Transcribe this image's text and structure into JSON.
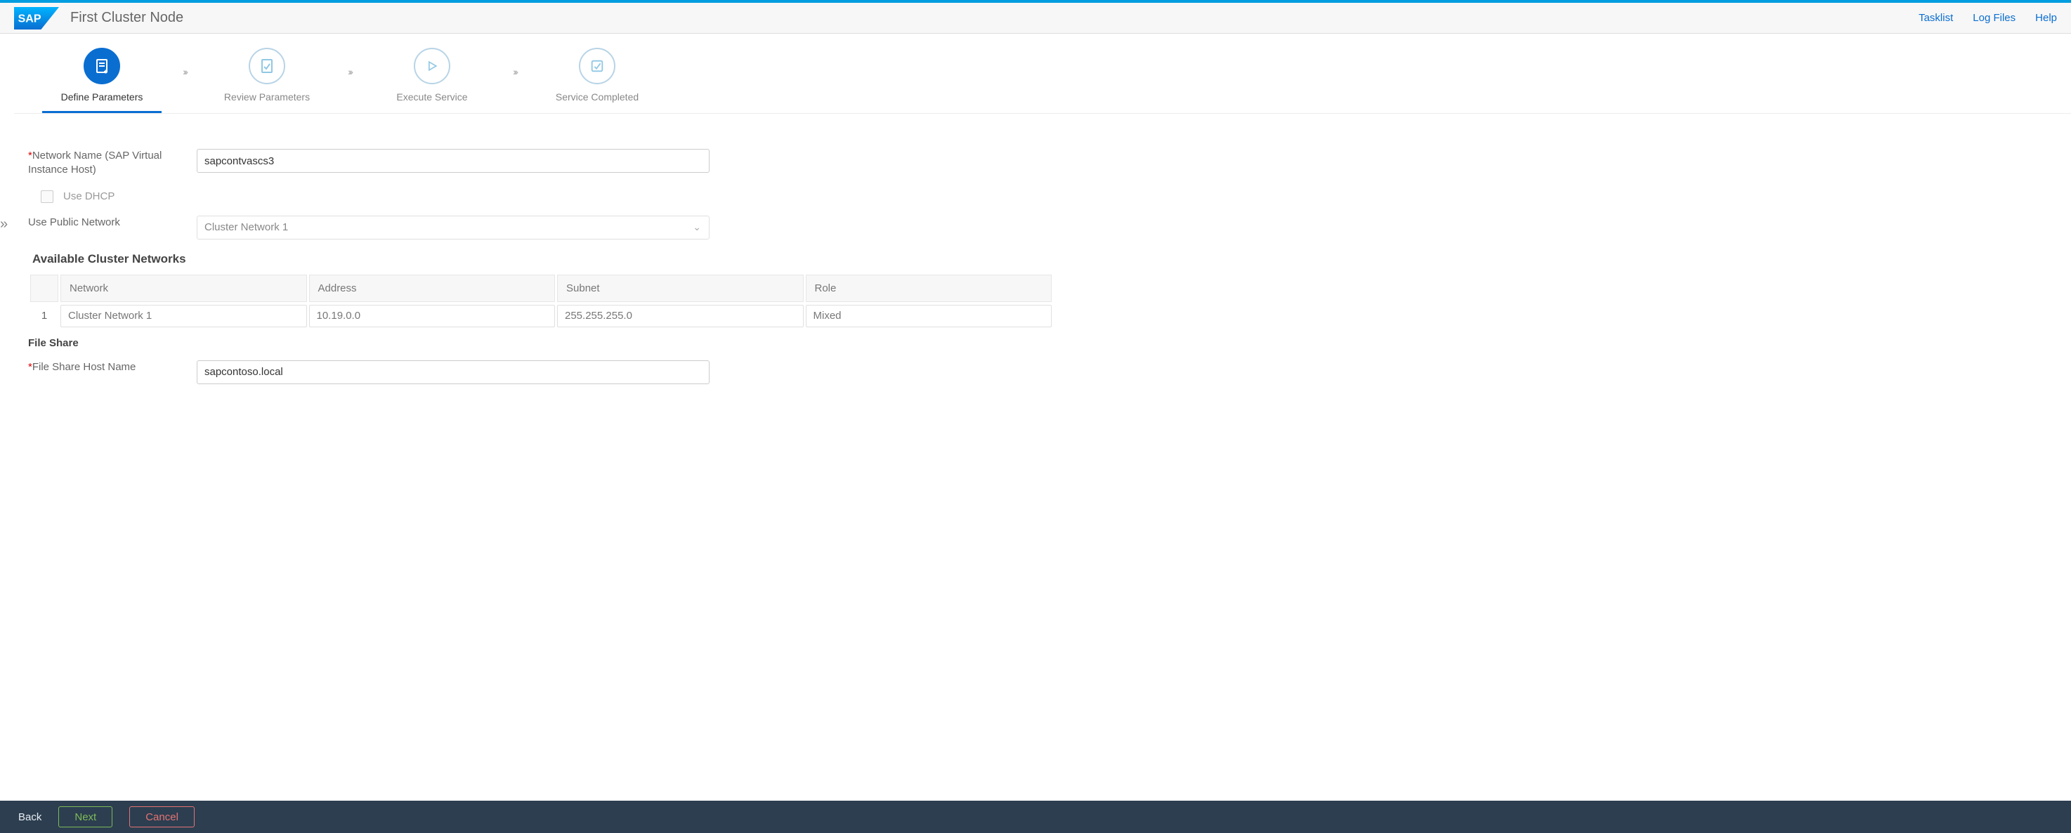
{
  "header": {
    "logo_text": "SAP",
    "title": "First Cluster Node",
    "links": {
      "tasklist": "Tasklist",
      "logfiles": "Log Files",
      "help": "Help"
    }
  },
  "wizard": {
    "steps": [
      {
        "label": "Define Parameters",
        "active": true
      },
      {
        "label": "Review Parameters",
        "active": false
      },
      {
        "label": "Execute Service",
        "active": false
      },
      {
        "label": "Service Completed",
        "active": false
      }
    ]
  },
  "form": {
    "network_name_label": "Network Name (SAP Virtual Instance Host)",
    "network_name_value": "sapcontvascs3",
    "use_dhcp_label": "Use DHCP",
    "use_dhcp_checked": false,
    "use_public_network_label": "Use Public Network",
    "use_public_network_value": "Cluster Network 1",
    "available_networks_heading": "Available Cluster Networks",
    "file_share_heading": "File Share",
    "file_share_host_label": "File Share Host Name",
    "file_share_host_value": "sapcontoso.local"
  },
  "table": {
    "columns": {
      "network": "Network",
      "address": "Address",
      "subnet": "Subnet",
      "role": "Role"
    },
    "rows": [
      {
        "idx": "1",
        "network": "Cluster Network 1",
        "address": "10.19.0.0",
        "subnet": "255.255.255.0",
        "role": "Mixed"
      }
    ]
  },
  "footer": {
    "back": "Back",
    "next": "Next",
    "cancel": "Cancel"
  }
}
